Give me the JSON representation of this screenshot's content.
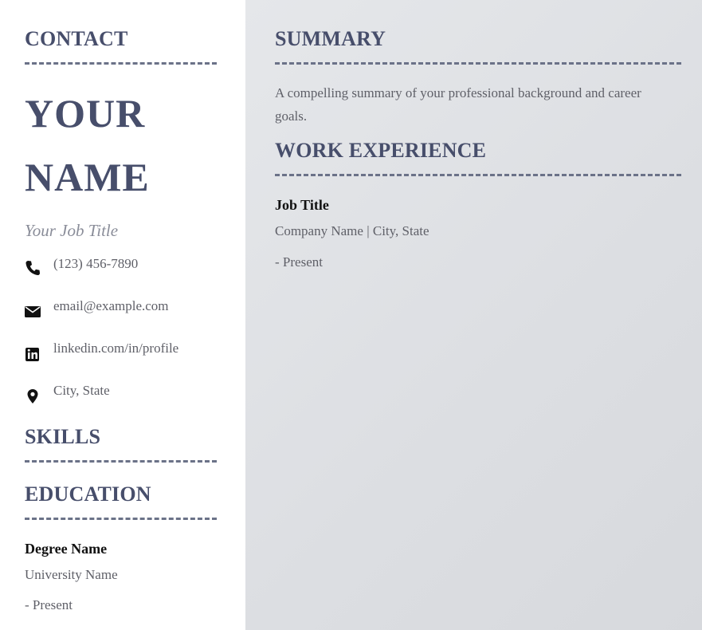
{
  "sidebar": {
    "contact_heading": "CONTACT",
    "name_line1": "YOUR",
    "name_line2": "NAME",
    "job_title": "Your Job Title",
    "contacts": [
      {
        "icon": "phone-icon",
        "text": "(123) 456-7890"
      },
      {
        "icon": "envelope-icon",
        "text": "email@example.com"
      },
      {
        "icon": "linkedin-icon",
        "text": "linkedin.com/in/profile"
      },
      {
        "icon": "map-pin-icon",
        "text": "City, State"
      }
    ],
    "skills_heading": "SKILLS",
    "education_heading": "EDUCATION",
    "education": {
      "degree": "Degree Name",
      "school": "University Name",
      "dates": "- Present"
    }
  },
  "main": {
    "summary_heading": "SUMMARY",
    "summary_text": "A compelling summary of your professional background and career goals.",
    "work_heading": "WORK EXPERIENCE",
    "job": {
      "title": "Job Title",
      "company_line": "Company Name | City, State",
      "dates": "- Present"
    }
  },
  "colors": {
    "heading": "#474e6b",
    "divider": "#6b7288",
    "main_background": "#e0e2e6",
    "body_text": "#5f6068"
  }
}
